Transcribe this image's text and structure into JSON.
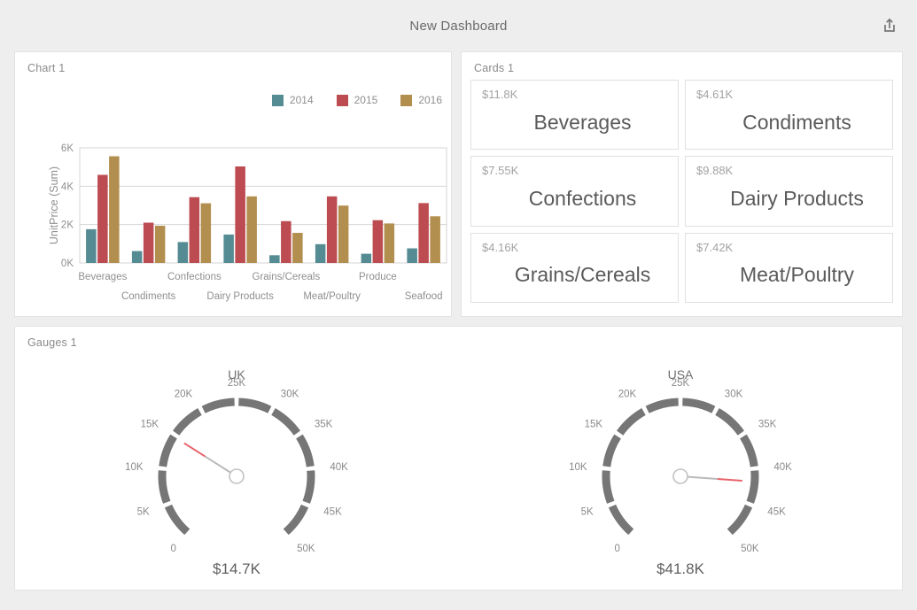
{
  "header": {
    "title": "New Dashboard",
    "share_icon": "share-export-icon"
  },
  "chart_panel": {
    "title": "Chart 1"
  },
  "cards_panel": {
    "title": "Cards 1",
    "cards": [
      {
        "value": "$11.8K",
        "label": "Beverages"
      },
      {
        "value": "$4.61K",
        "label": "Condiments"
      },
      {
        "value": "$7.55K",
        "label": "Confections"
      },
      {
        "value": "$9.88K",
        "label": "Dairy Products"
      },
      {
        "value": "$4.16K",
        "label": "Grains/Cereals"
      },
      {
        "value": "$7.42K",
        "label": "Meat/Poultry"
      }
    ]
  },
  "gauges_panel": {
    "title": "Gauges 1",
    "gauges": [
      {
        "title": "UK",
        "value_label": "$14.7K",
        "value": 14700,
        "min": 0,
        "max": 50000,
        "ticks": [
          "0",
          "5K",
          "10K",
          "15K",
          "20K",
          "25K",
          "30K",
          "35K",
          "40K",
          "45K",
          "50K"
        ]
      },
      {
        "title": "USA",
        "value_label": "$41.8K",
        "value": 41800,
        "min": 0,
        "max": 50000,
        "ticks": [
          "0",
          "5K",
          "10K",
          "15K",
          "20K",
          "25K",
          "30K",
          "35K",
          "40K",
          "45K",
          "50K"
        ]
      }
    ]
  },
  "colors": {
    "series_2014": "#558b92",
    "series_2015": "#bc4b52",
    "series_2016": "#b28e4f",
    "page_background": "#eeeeee",
    "panel_background": "#ffffff",
    "gauge_arc": "#767676",
    "gauge_needle_tip": "#e8646b"
  },
  "chart_data": {
    "type": "bar",
    "title": "Chart 1",
    "xlabel": "",
    "ylabel": "UnitPrice (Sum)",
    "ylim": [
      0,
      6000
    ],
    "ytick_labels": [
      "0K",
      "2K",
      "4K",
      "6K"
    ],
    "ytick_values": [
      0,
      2000,
      4000,
      6000
    ],
    "grid": true,
    "legend_position": "top-right",
    "categories": [
      "Beverages",
      "Condiments",
      "Confections",
      "Dairy Products",
      "Grains/Cereals",
      "Meat/Poultry",
      "Produce",
      "Seafood"
    ],
    "series": [
      {
        "name": "2014",
        "color": "#558b92",
        "values": [
          1760,
          620,
          1090,
          1480,
          400,
          980,
          480,
          760
        ]
      },
      {
        "name": "2015",
        "color": "#bc4b52",
        "values": [
          4590,
          2100,
          3430,
          5030,
          2180,
          3470,
          2230,
          3120
        ]
      },
      {
        "name": "2016",
        "color": "#b28e4f",
        "values": [
          5560,
          1940,
          3110,
          3470,
          1570,
          2990,
          2060,
          2430
        ]
      }
    ]
  }
}
